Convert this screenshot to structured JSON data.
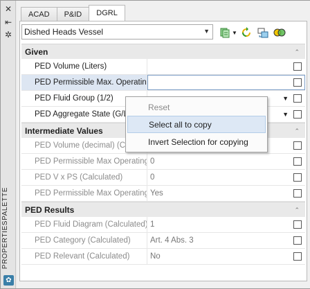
{
  "palette": {
    "title": "PROPERTIESPALETTE",
    "icons": [
      "close-icon",
      "auto-hide-icon",
      "settings-icon",
      "palette-logo-icon"
    ]
  },
  "tabs": [
    {
      "label": "ACAD",
      "active": false
    },
    {
      "label": "P&ID",
      "active": false
    },
    {
      "label": "DGRL",
      "active": true
    }
  ],
  "toolbar": {
    "vessel_select": "Dished Heads Vessel",
    "icons": [
      "quick-select-icon",
      "refresh-icon",
      "export-icon",
      "compare-icon"
    ]
  },
  "sections": [
    {
      "title": "Given",
      "rows": [
        {
          "name": "PED Volume (Liters)",
          "value": ""
        },
        {
          "name": "PED Permissible Max. Operating...",
          "value": ""
        },
        {
          "name": "PED Fluid Group (1/2)",
          "value": ""
        },
        {
          "name": "PED Aggregate State (G/L)",
          "value": ""
        }
      ]
    },
    {
      "title": "Intermediate Values",
      "rows": [
        {
          "name": "PED Volume (decimal) (Calcul",
          "value": ""
        },
        {
          "name": "PED Permissible Max Operating ...",
          "value": "0"
        },
        {
          "name": "PED V x PS (Calculated)",
          "value": "0"
        },
        {
          "name": "PED Permissible Max Operating ...",
          "value": "Yes"
        }
      ]
    },
    {
      "title": "PED Results",
      "rows": [
        {
          "name": "PED Fluid Diagram (Calculated)",
          "value": "1"
        },
        {
          "name": "PED Category (Calculated)",
          "value": "Art. 4 Abs. 3"
        },
        {
          "name": "PED Relevant (Calculated)",
          "value": "No"
        }
      ]
    }
  ],
  "context_menu": {
    "items": [
      {
        "label": "Reset",
        "disabled": true
      },
      {
        "label": "Select all to copy",
        "hovered": true
      },
      {
        "label": "Invert Selection for copying"
      }
    ]
  },
  "colors": {
    "selection": "#dde6f2",
    "menu_hover": "#dde8f5",
    "accent": "#3a7fa8"
  }
}
